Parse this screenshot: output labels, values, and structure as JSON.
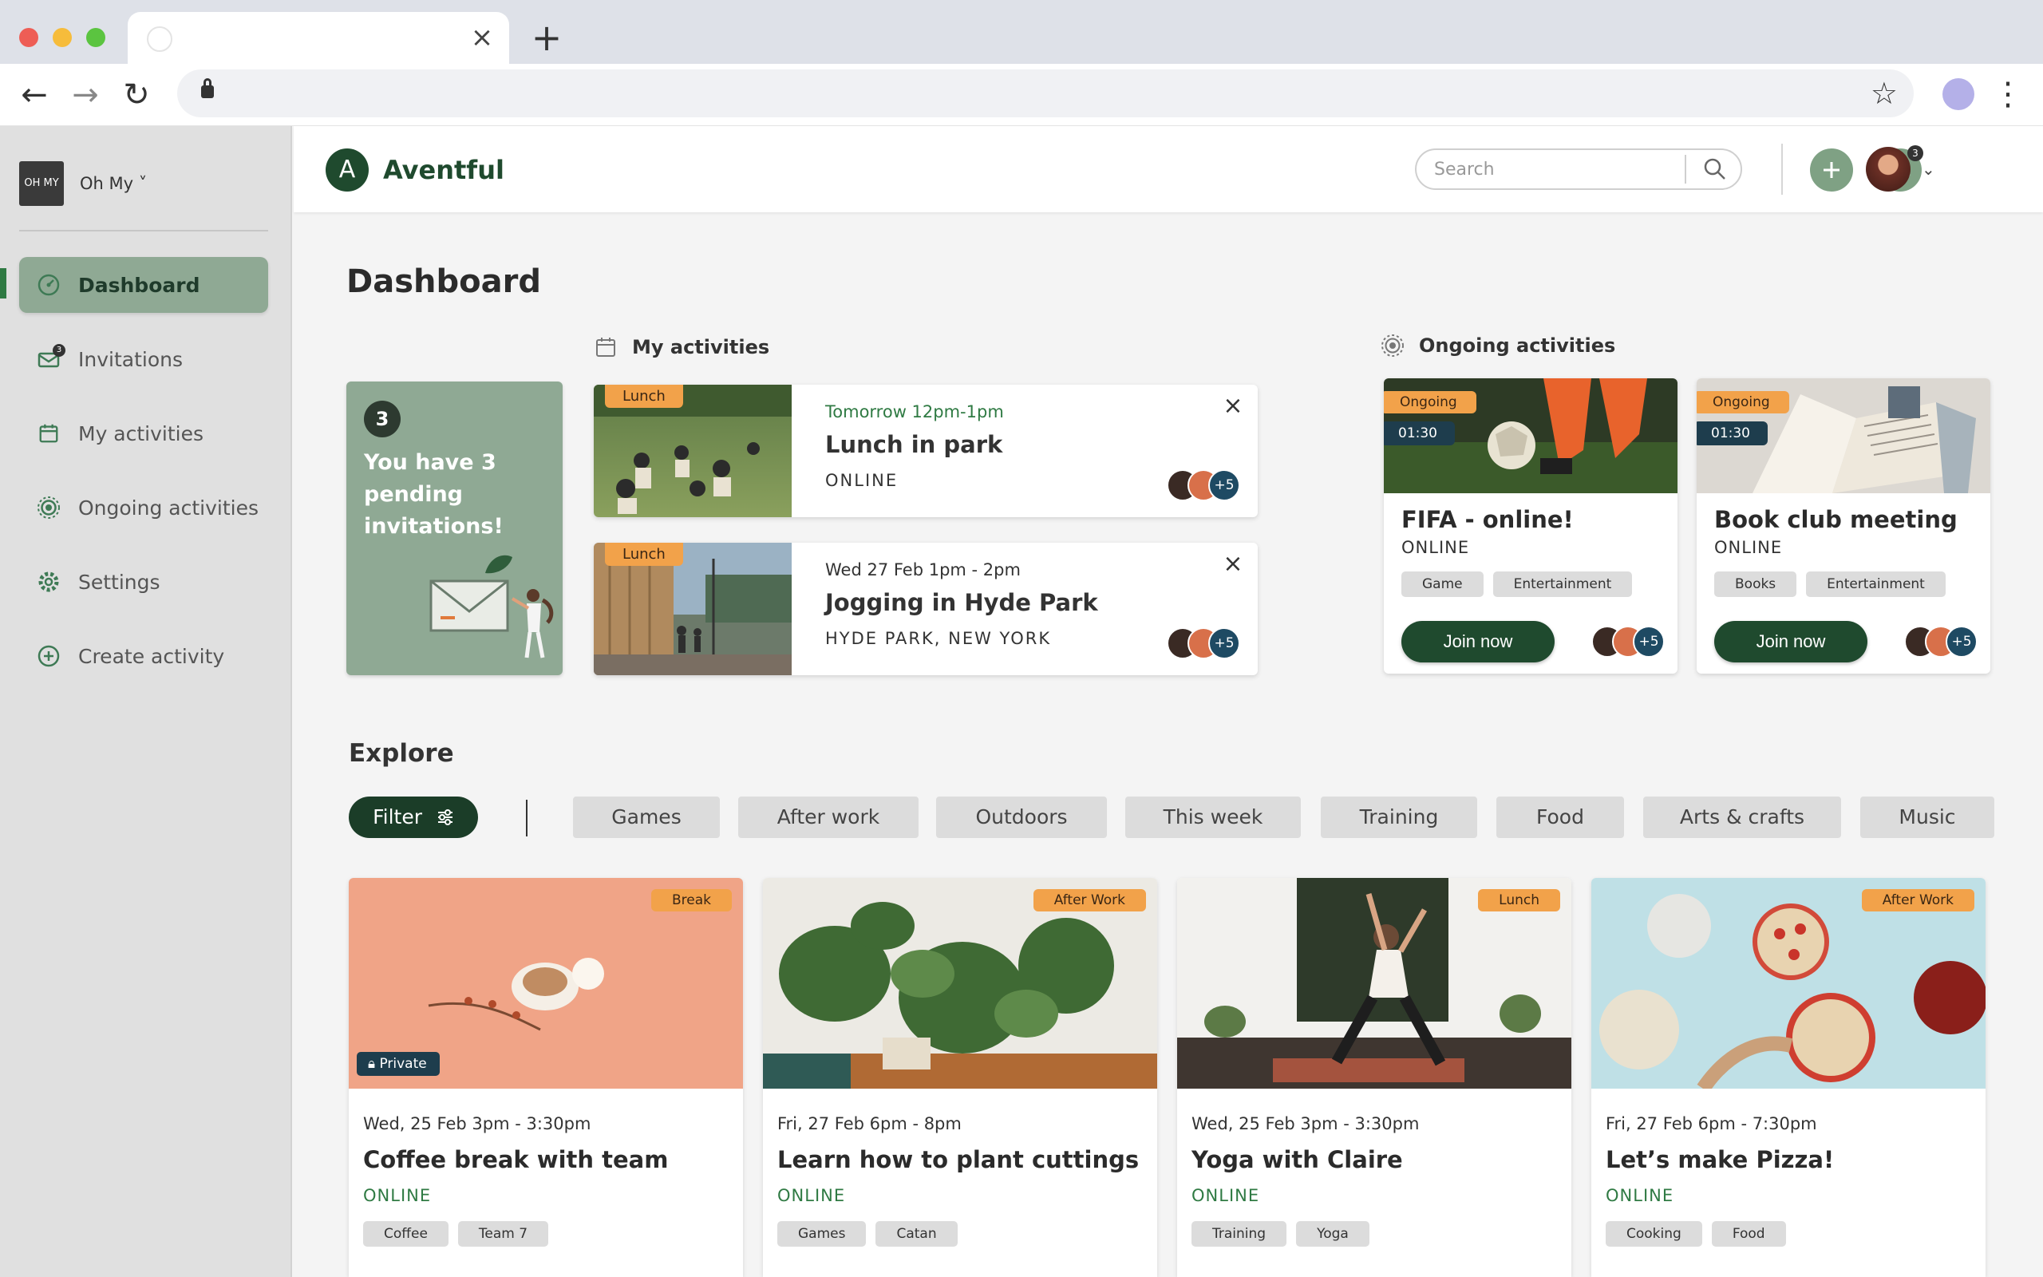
{
  "browser": {
    "tab_title": "",
    "url": ""
  },
  "org": {
    "logo_text": "OH MY",
    "name": "Oh My ˅"
  },
  "sidebar": {
    "items": [
      {
        "label": "Dashboard",
        "icon": "gauge-icon"
      },
      {
        "label": "Invitations",
        "icon": "mail-icon",
        "badge": "3"
      },
      {
        "label": "My activities",
        "icon": "calendar-icon"
      },
      {
        "label": "Ongoing activities",
        "icon": "radar-icon"
      },
      {
        "label": "Settings",
        "icon": "gear-icon"
      },
      {
        "label": "Create activity",
        "icon": "plus-circle-icon"
      }
    ]
  },
  "header": {
    "brand_initial": "A",
    "brand_name": "Aventful",
    "search_placeholder": "Search",
    "mail_badge": "3"
  },
  "page": {
    "title": "Dashboard"
  },
  "my_activities": {
    "heading": "My activities",
    "pending": {
      "count": "3",
      "text": "You have  3 pending invitations!"
    },
    "cards": [
      {
        "tag": "Lunch",
        "time": "Tomorrow 12pm-1pm",
        "title": "Lunch in park",
        "location": "ONLINE",
        "more": "+5"
      },
      {
        "tag": "Lunch",
        "time": "Wed 27 Feb 1pm - 2pm",
        "title": "Jogging in Hyde Park",
        "location": "HYDE PARK, NEW YORK",
        "more": "+5"
      }
    ]
  },
  "ongoing": {
    "heading": "Ongoing activities",
    "cards": [
      {
        "status": "Ongoing",
        "elapsed": "01:30",
        "title": "FIFA - online!",
        "sub": "ONLINE",
        "chips": [
          "Game",
          "Entertainment"
        ],
        "button": "Join now",
        "more": "+5"
      },
      {
        "status": "Ongoing",
        "elapsed": "01:30",
        "title": "Book club meeting",
        "sub": "ONLINE",
        "chips": [
          "Books",
          "Entertainment"
        ],
        "button": "Join now",
        "more": "+5"
      }
    ]
  },
  "explore": {
    "title": "Explore",
    "filter_label": "Filter",
    "categories": [
      "Games",
      "After work",
      "Outdoors",
      "This week",
      "Training",
      "Food",
      "Arts & crafts",
      "Music"
    ],
    "cards": [
      {
        "tag": "Break",
        "private": "Private",
        "time": "Wed, 25 Feb 3pm - 3:30pm",
        "title": "Coffee break with team",
        "sub": "ONLINE",
        "chips": [
          "Coffee",
          "Team 7"
        ]
      },
      {
        "tag": "After Work",
        "time": "Fri, 27 Feb 6pm - 8pm",
        "title": "Learn how to plant cuttings",
        "sub": "ONLINE",
        "chips": [
          "Games",
          "Catan"
        ]
      },
      {
        "tag": "Lunch",
        "time": "Wed, 25 Feb 3pm - 3:30pm",
        "title": "Yoga with Claire",
        "sub": "ONLINE",
        "chips": [
          "Training",
          "Yoga"
        ]
      },
      {
        "tag": "After Work",
        "time": "Fri, 27 Feb 6pm - 7:30pm",
        "title": "Let’s make Pizza!",
        "sub": "ONLINE",
        "chips": [
          "Cooking",
          "Food"
        ]
      }
    ]
  },
  "colors": {
    "brand_green": "#1f4a2e",
    "sage": "#8fa994",
    "orange_tag": "#f2a24a",
    "navy_tag": "#1e3d4d"
  }
}
